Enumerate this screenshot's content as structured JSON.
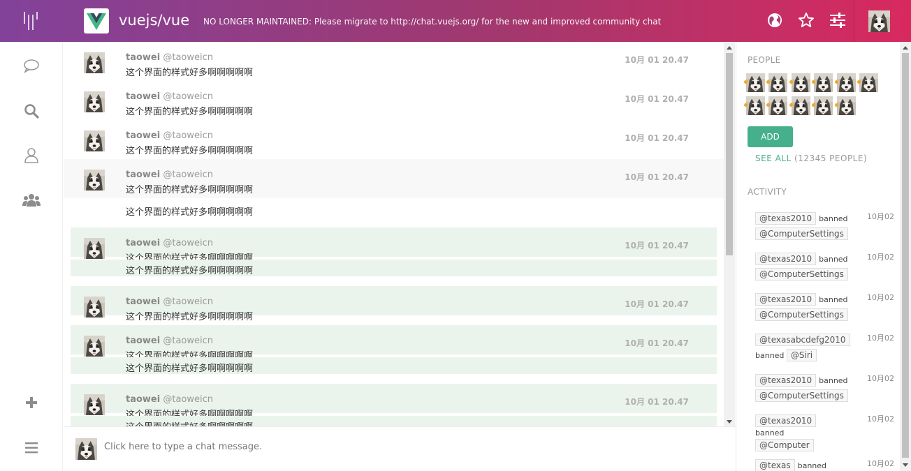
{
  "header": {
    "repo_name": "vuejs/vue",
    "topic": "NO LONGER MAINTAINED: Please migrate to http://chat.vuejs.org/ for the new and improved community chat",
    "icons": [
      "globe-icon",
      "star-icon",
      "settings-sliders-icon"
    ],
    "colors": {
      "start": "#82429a",
      "end": "#d8295f"
    }
  },
  "leftnav": {
    "items": [
      "chat-bubble-icon",
      "search-icon",
      "person-icon",
      "people-icon",
      "plus-icon",
      "hamburger-menu-icon"
    ]
  },
  "messages": [
    {
      "user": "taowei",
      "handle": "@taoweicn",
      "time": "10月 01 20.47",
      "text": "这个界面的样式好多啊啊啊啊啊",
      "state": "normal",
      "extra": []
    },
    {
      "user": "taowei",
      "handle": "@taoweicn",
      "time": "10月 01 20.47",
      "text": "这个界面的样式好多啊啊啊啊啊",
      "state": "normal",
      "extra": []
    },
    {
      "user": "taowei",
      "handle": "@taoweicn",
      "time": "10月 01 20.47",
      "text": "这个界面的样式好多啊啊啊啊啊",
      "state": "normal",
      "extra": []
    },
    {
      "user": "taowei",
      "handle": "@taoweicn",
      "time": "10月 01 20.47",
      "text": "这个界面的样式好多啊啊啊啊啊",
      "state": "hover",
      "extra": [
        "这个界面的样式好多啊啊啊啊啊"
      ]
    },
    {
      "user": "taowei",
      "handle": "@taoweicn",
      "time": "10月 01 20.47",
      "text": "这个界面的样式好多啊啊啊啊啊",
      "state": "unread",
      "extra": [
        "这个界面的样式好多啊啊啊啊啊"
      ]
    },
    {
      "user": "taowei",
      "handle": "@taoweicn",
      "time": "10月 01 20.47",
      "text": "这个界面的样式好多啊啊啊啊啊",
      "state": "unread",
      "extra": []
    },
    {
      "user": "taowei",
      "handle": "@taoweicn",
      "time": "10月 01 20.47",
      "text": "这个界面的样式好多啊啊啊啊啊",
      "state": "unread",
      "extra": [
        "这个界面的样式好多啊啊啊啊啊"
      ]
    },
    {
      "user": "taowei",
      "handle": "@taoweicn",
      "time": "10月 01 20.47",
      "text": "这个界面的样式好多啊啊啊啊啊",
      "state": "unread",
      "extra": [
        "这个界面的样式好多啊啊啊啊啊"
      ]
    }
  ],
  "composer": {
    "placeholder": "Click here to type a chat message."
  },
  "right": {
    "people_title": "PEOPLE",
    "people_count_shown": 11,
    "add_label": "ADD",
    "see_all_link": "SEE ALL",
    "see_all_count": "(12345 PEOPLE)",
    "activity_title": "ACTIVITY",
    "activity": [
      {
        "actor": "@texas2010",
        "verb": "banned",
        "target": "@ComputerSettings",
        "date": "10月02"
      },
      {
        "actor": "@texas2010",
        "verb": "banned",
        "target": "@ComputerSettings",
        "date": "10月02"
      },
      {
        "actor": "@texas2010",
        "verb": "banned",
        "target": "@ComputerSettings",
        "date": "10月02"
      },
      {
        "actor": "@texasabcdefg2010",
        "verb": "banned",
        "target": "@Siri",
        "date": "10月02"
      },
      {
        "actor": "@texas2010",
        "verb": "banned",
        "target": "@ComputerSettings",
        "date": "10月02"
      },
      {
        "actor": "@texas2010",
        "verb": "banned",
        "target": "@Computer",
        "date": "10月02"
      },
      {
        "actor": "@texas",
        "verb": "banned",
        "target": "",
        "date": "10月02"
      }
    ],
    "accent": "#46af8b"
  }
}
